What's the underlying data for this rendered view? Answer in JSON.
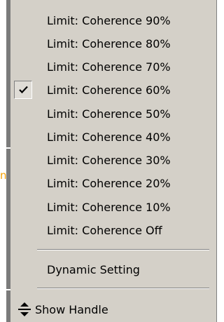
{
  "menu": {
    "limit_items": [
      {
        "label": "Limit: Coherence 90%",
        "checked": false
      },
      {
        "label": "Limit: Coherence 80%",
        "checked": false
      },
      {
        "label": "Limit: Coherence 70%",
        "checked": false
      },
      {
        "label": "Limit: Coherence 60%",
        "checked": true
      },
      {
        "label": "Limit: Coherence 50%",
        "checked": false
      },
      {
        "label": "Limit: Coherence 40%",
        "checked": false
      },
      {
        "label": "Limit: Coherence 30%",
        "checked": false
      },
      {
        "label": "Limit: Coherence 20%",
        "checked": false
      },
      {
        "label": "Limit: Coherence 10%",
        "checked": false
      },
      {
        "label": "Limit: Coherence Off",
        "checked": false
      }
    ],
    "dynamic_setting": {
      "label": "Dynamic Setting"
    },
    "show_handle": {
      "label": "Show Handle",
      "icon": "resize-vertical-icon"
    }
  },
  "icons": {
    "checked_item": "checkmark-icon"
  },
  "colors": {
    "menu_bg": "#d4d0c8",
    "separator_dark": "#808080",
    "separator_light": "#ffffff",
    "background_accent": "#f5a000"
  }
}
